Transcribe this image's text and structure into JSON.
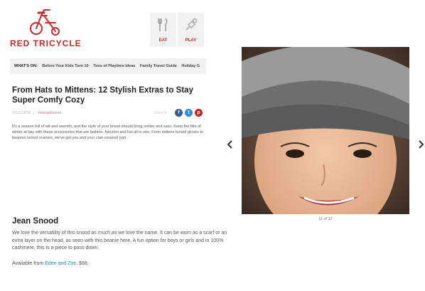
{
  "brand": {
    "name": "RED TRICYCLE",
    "accent": "#c62a2a"
  },
  "nav": {
    "eat_label": "EAT",
    "play_label": "PLAY",
    "eat_icon": "fork-knife-icon",
    "play_icon": "puzzle-icon"
  },
  "sub_nav": {
    "label": "WHAT'S ON:",
    "items": [
      "Before Your Kids Turn 10",
      "Tons of Playtime Ideas",
      "Family Travel Guide",
      "Holiday G"
    ]
  },
  "article": {
    "title": "From Hats to Mittens: 12 Stylish Extras to Stay Super Comfy Cozy",
    "date": "2013/1/8/08",
    "author": "mseraphreene",
    "share_label": "Share it",
    "intro": "It's a season full of wit and warmth, and the style of your brood should bring smiles and sass.  Keep the bite of winter at bay with these accessories that are fashion, function and fun all in one. From mittens turned gloves to beanies turned scarves, we've got you and your clan covered (up).",
    "social": [
      {
        "name": "facebook",
        "glyph": "f",
        "color": "#3b5998"
      },
      {
        "name": "twitter",
        "glyph": "t",
        "color": "#2e8fd6"
      },
      {
        "name": "pinterest",
        "glyph": "p",
        "color": "#cb2027"
      }
    ]
  },
  "item": {
    "title": "Jean Snood",
    "description": "We love the versatility of this snood as much as we love the name. It can be worn as a scarf or an extra layer on the head, as seen with this beanie here.  A fun option for boys or girls and in 100% cashmere, this is a piece to pass down.",
    "avail_prefix": "Available from ",
    "avail_link": "Eden and Zoe",
    "avail_suffix": ", $68."
  },
  "gallery": {
    "counter": "11 of 12",
    "prev_icon": "chevron-left-icon",
    "next_icon": "chevron-right-icon"
  }
}
